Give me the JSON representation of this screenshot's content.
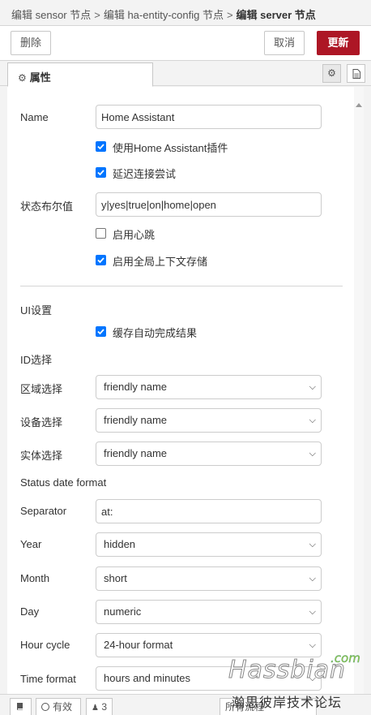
{
  "header": {
    "crumb1": "编辑 sensor 节点",
    "sep1": ">",
    "crumb2": "编辑 ha-entity-config 节点",
    "sep2": ">",
    "crumb3": "编辑 server 节点"
  },
  "toolbar": {
    "delete_label": "删除",
    "cancel_label": "取消",
    "update_label": "更新"
  },
  "tabs": {
    "properties_label": "属性",
    "properties_icon": "gear-icon",
    "settings_icon": "gear-icon",
    "description_icon": "document-icon"
  },
  "form": {
    "name_label": "Name",
    "name_value": "Home Assistant",
    "cb_use_addon_label": "使用Home Assistant插件",
    "cb_use_addon_checked": true,
    "cb_retry_label": "延迟连接尝试",
    "cb_retry_checked": true,
    "bool_label": "状态布尔值",
    "bool_value": "y|yes|true|on|home|open",
    "cb_heartbeat_label": "启用心跳",
    "cb_heartbeat_checked": false,
    "cb_global_ctx_label": "启用全局上下文存储",
    "cb_global_ctx_checked": true,
    "ui_settings_label": "UI设置",
    "cb_cache_label": "缓存自动完成结果",
    "cb_cache_checked": true,
    "id_select_label": "ID选择",
    "area_label": "区域选择",
    "area_value": "friendly name",
    "device_label": "设备选择",
    "device_value": "friendly name",
    "entity_label": "实体选择",
    "entity_value": "friendly name",
    "status_date_format_label": "Status date format",
    "separator_label": "Separator",
    "separator_value": "at:",
    "year_label": "Year",
    "year_value": "hidden",
    "month_label": "Month",
    "month_value": "short",
    "day_label": "Day",
    "day_value": "numeric",
    "hour_cycle_label": "Hour cycle",
    "hour_cycle_value": "24-hour format",
    "time_format_label": "Time format",
    "time_format_value": "hours and minutes"
  },
  "footer": {
    "book_icon": "book-icon",
    "valid_label": "有效",
    "users_count": "3",
    "flows_label": "所有流程"
  },
  "watermark": {
    "main": "Hassbian",
    "com": ".com",
    "sub": "瀚思彼岸技术论坛"
  },
  "colors": {
    "update_button": "#ad1625",
    "checkbox": "#0075ff"
  }
}
